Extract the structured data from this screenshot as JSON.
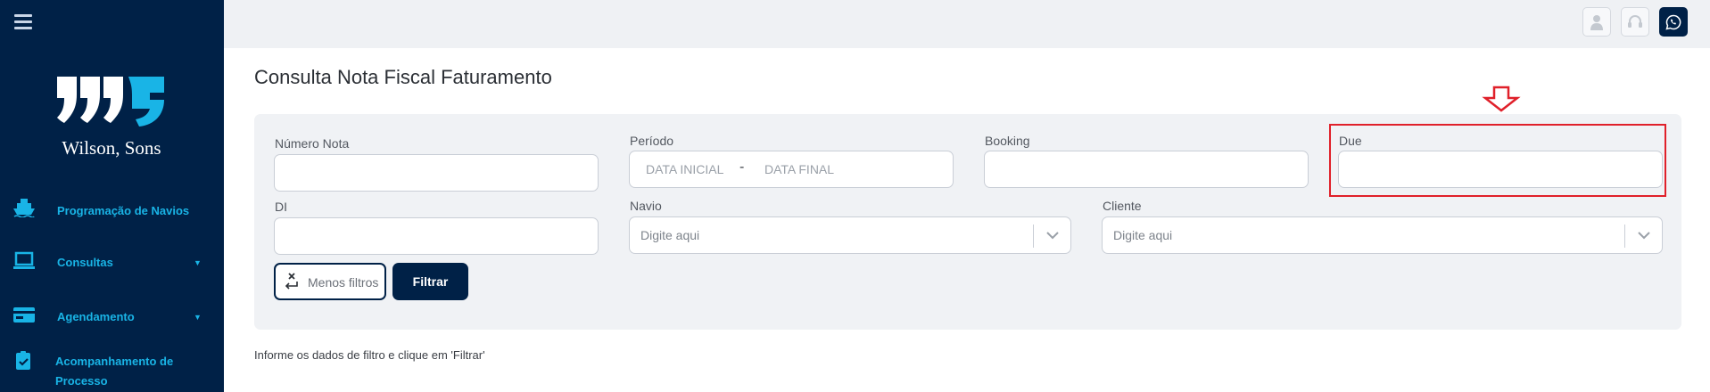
{
  "sidebar": {
    "brand": "Wilson, Sons",
    "items": [
      {
        "label": "Programação de Navios",
        "icon": "ship-icon",
        "has_caret": false
      },
      {
        "label": "Consultas",
        "icon": "laptop-icon",
        "has_caret": true
      },
      {
        "label": "Agendamento",
        "icon": "card-icon",
        "has_caret": true
      },
      {
        "label_line1": "Acompanhamento de",
        "label_line2": "Processo",
        "icon": "clipboard-check-icon"
      }
    ]
  },
  "topbar": {
    "buttons": [
      "user-icon",
      "headset-icon",
      "whatsapp-icon"
    ]
  },
  "page": {
    "title": "Consulta Nota Fiscal Faturamento",
    "hint": "Informe os dados de filtro e clique em 'Filtrar'"
  },
  "filters": {
    "numero_nota": {
      "label": "Número Nota",
      "value": ""
    },
    "periodo": {
      "label": "Período",
      "start_placeholder": "DATA INICIAL",
      "separator": "-",
      "end_placeholder": "DATA FINAL"
    },
    "booking": {
      "label": "Booking",
      "value": ""
    },
    "due": {
      "label": "Due",
      "value": ""
    },
    "di": {
      "label": "DI",
      "value": ""
    },
    "navio": {
      "label": "Navio",
      "placeholder": "Digite aqui"
    },
    "cliente": {
      "label": "Cliente",
      "placeholder": "Digite aqui"
    },
    "less_filters_label": "Menos filtros",
    "filter_button_label": "Filtrar"
  },
  "colors": {
    "sidebar_bg": "#002147",
    "accent": "#19b4e6",
    "highlight": "#e0202a"
  }
}
